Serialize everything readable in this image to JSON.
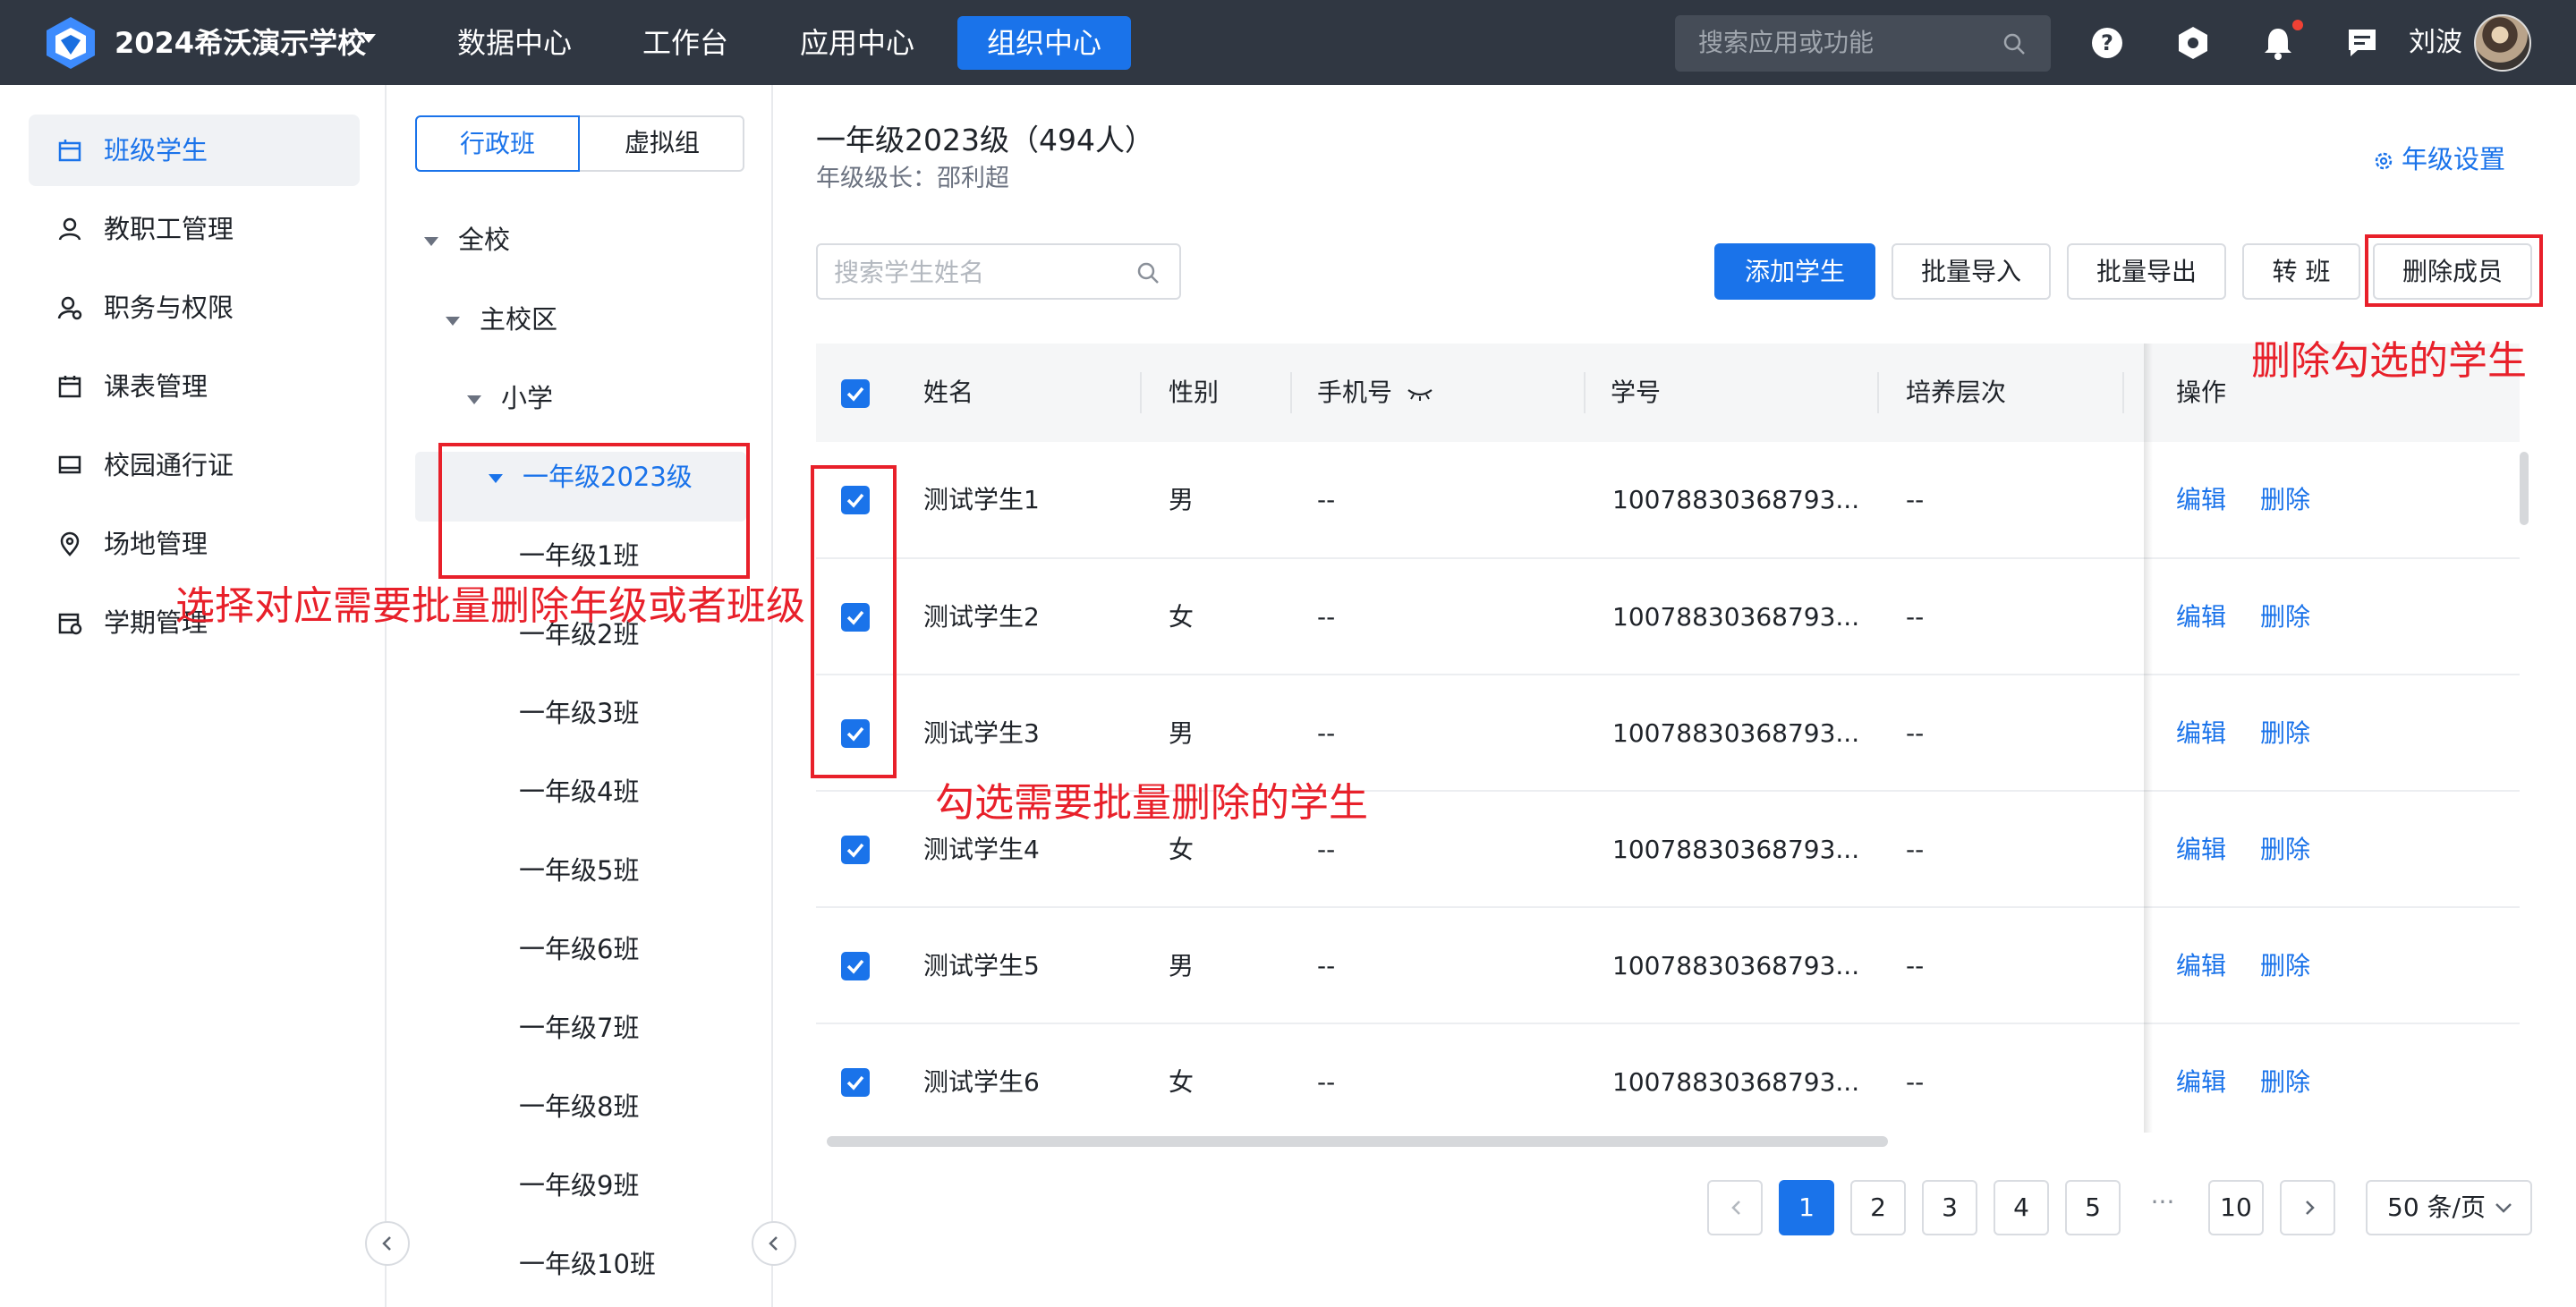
{
  "header": {
    "school_name": "2024希沃演示学校",
    "nav": [
      "数据中心",
      "工作台",
      "应用中心",
      "组织中心"
    ],
    "active_nav": "组织中心",
    "search_placeholder": "搜索应用或功能",
    "user_name": "刘波",
    "icons": [
      "help-icon",
      "settings-icon",
      "bell-icon",
      "chat-icon"
    ]
  },
  "sidebar": {
    "items": [
      {
        "label": "班级学生",
        "icon": "class-icon",
        "active": true
      },
      {
        "label": "教职工管理",
        "icon": "user-icon"
      },
      {
        "label": "职务与权限",
        "icon": "user-permission-icon"
      },
      {
        "label": "课表管理",
        "icon": "calendar-icon"
      },
      {
        "label": "校园通行证",
        "icon": "card-icon"
      },
      {
        "label": "场地管理",
        "icon": "location-icon"
      },
      {
        "label": "学期管理",
        "icon": "semester-icon"
      }
    ]
  },
  "tree": {
    "tabs": [
      "行政班",
      "虚拟组"
    ],
    "active_tab": "行政班",
    "nodes": [
      {
        "label": "全校",
        "expanded": true
      },
      {
        "label": "主校区",
        "expanded": true
      },
      {
        "label": "小学",
        "expanded": true
      },
      {
        "label": "一年级2023级",
        "expanded": true,
        "selected": true
      },
      {
        "label": "一年级1班"
      },
      {
        "label": "一年级2班"
      },
      {
        "label": "一年级3班"
      },
      {
        "label": "一年级4班"
      },
      {
        "label": "一年级5班"
      },
      {
        "label": "一年级6班"
      },
      {
        "label": "一年级7班"
      },
      {
        "label": "一年级8班"
      },
      {
        "label": "一年级9班"
      },
      {
        "label": "一年级10班"
      }
    ]
  },
  "main": {
    "title": "一年级2023级（494人）",
    "leader": "年级级长：邵利超",
    "settings_label": "年级设置",
    "search_placeholder": "搜索学生姓名",
    "buttons": {
      "add": "添加学生",
      "import": "批量导入",
      "export": "批量导出",
      "transfer": "转 班",
      "delete": "删除成员"
    },
    "columns": [
      "姓名",
      "性别",
      "手机号",
      "学号",
      "培养层次",
      "操作"
    ],
    "rows": [
      {
        "name": "测试学生1",
        "gender": "男",
        "phone": "--",
        "id": "10078830368793...",
        "level": "--",
        "edit": "编辑",
        "delete": "删除",
        "checked": true
      },
      {
        "name": "测试学生2",
        "gender": "女",
        "phone": "--",
        "id": "10078830368793...",
        "level": "--",
        "edit": "编辑",
        "delete": "删除",
        "checked": true
      },
      {
        "name": "测试学生3",
        "gender": "男",
        "phone": "--",
        "id": "10078830368793...",
        "level": "--",
        "edit": "编辑",
        "delete": "删除",
        "checked": true
      },
      {
        "name": "测试学生4",
        "gender": "女",
        "phone": "--",
        "id": "10078830368793...",
        "level": "--",
        "edit": "编辑",
        "delete": "删除",
        "checked": true
      },
      {
        "name": "测试学生5",
        "gender": "男",
        "phone": "--",
        "id": "10078830368793...",
        "level": "--",
        "edit": "编辑",
        "delete": "删除",
        "checked": true
      },
      {
        "name": "测试学生6",
        "gender": "女",
        "phone": "--",
        "id": "10078830368793...",
        "level": "--",
        "edit": "编辑",
        "delete": "删除",
        "checked": true
      }
    ]
  },
  "pagination": {
    "pages": [
      "1",
      "2",
      "3",
      "4",
      "5"
    ],
    "current": "1",
    "ellipsis": "···",
    "last": "10",
    "page_size": "50 条/页"
  },
  "annotations": {
    "tree": "选择对应需要批量删除年级或者班级",
    "checkbox": "勾选需要批量删除的学生",
    "delete": "删除勾选的学生"
  },
  "colors": {
    "primary": "#1a73ea",
    "topbar": "#303742",
    "annotation": "#e8202a"
  }
}
